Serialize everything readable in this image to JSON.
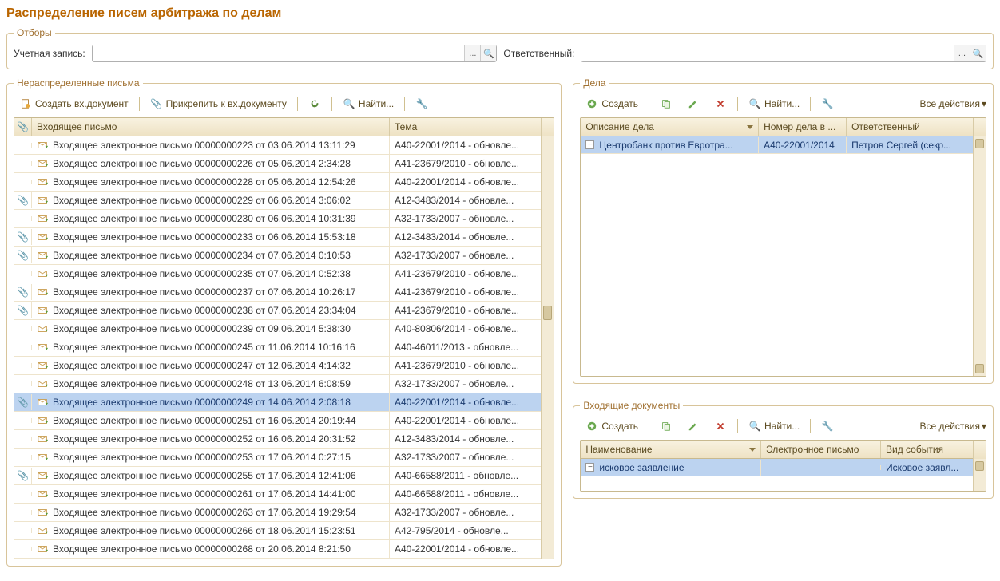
{
  "title": "Распределение писем арбитража по делам",
  "filters": {
    "legend": "Отборы",
    "account_label": "Учетная запись:",
    "account_value": "",
    "responsible_label": "Ответственный:",
    "responsible_value": ""
  },
  "letters": {
    "legend": "Нераспределенные письма",
    "toolbar": {
      "create": "Создать вх.документ",
      "attach": "Прикрепить к вх.документу",
      "find": "Найти..."
    },
    "columns": {
      "attach": "",
      "letter": "Входящее письмо",
      "subject": "Тема"
    },
    "rows": [
      {
        "att": false,
        "letter": "Входящее электронное письмо 00000000223 от 03.06.2014 13:11:29",
        "subj": "А40-22001/2014 - обновле..."
      },
      {
        "att": false,
        "letter": "Входящее электронное письмо 00000000226 от 05.06.2014 2:34:28",
        "subj": "А41-23679/2010 - обновле..."
      },
      {
        "att": false,
        "letter": "Входящее электронное письмо 00000000228 от 05.06.2014 12:54:26",
        "subj": "А40-22001/2014 - обновле..."
      },
      {
        "att": true,
        "letter": "Входящее электронное письмо 00000000229 от 06.06.2014 3:06:02",
        "subj": "А12-3483/2014 - обновле..."
      },
      {
        "att": false,
        "letter": "Входящее электронное письмо 00000000230 от 06.06.2014 10:31:39",
        "subj": "А32-1733/2007 - обновле..."
      },
      {
        "att": true,
        "letter": "Входящее электронное письмо 00000000233 от 06.06.2014 15:53:18",
        "subj": "А12-3483/2014 - обновле..."
      },
      {
        "att": true,
        "letter": "Входящее электронное письмо 00000000234 от 07.06.2014 0:10:53",
        "subj": "А32-1733/2007 - обновле..."
      },
      {
        "att": false,
        "letter": "Входящее электронное письмо 00000000235 от 07.06.2014 0:52:38",
        "subj": "А41-23679/2010 - обновле..."
      },
      {
        "att": true,
        "letter": "Входящее электронное письмо 00000000237 от 07.06.2014 10:26:17",
        "subj": "А41-23679/2010 - обновле..."
      },
      {
        "att": true,
        "letter": "Входящее электронное письмо 00000000238 от 07.06.2014 23:34:04",
        "subj": "А41-23679/2010 - обновле..."
      },
      {
        "att": false,
        "letter": "Входящее электронное письмо 00000000239 от 09.06.2014 5:38:30",
        "subj": "А40-80806/2014 - обновле..."
      },
      {
        "att": false,
        "letter": "Входящее электронное письмо 00000000245 от 11.06.2014 10:16:16",
        "subj": "А40-46011/2013 - обновле..."
      },
      {
        "att": false,
        "letter": "Входящее электронное письмо 00000000247 от 12.06.2014 4:14:32",
        "subj": "А41-23679/2010 - обновле..."
      },
      {
        "att": false,
        "letter": "Входящее электронное письмо 00000000248 от 13.06.2014 6:08:59",
        "subj": "А32-1733/2007 - обновле..."
      },
      {
        "att": true,
        "letter": "Входящее электронное письмо 00000000249 от 14.06.2014 2:08:18",
        "subj": "А40-22001/2014 - обновле...",
        "selected": true
      },
      {
        "att": false,
        "letter": "Входящее электронное письмо 00000000251 от 16.06.2014 20:19:44",
        "subj": "А40-22001/2014 - обновле..."
      },
      {
        "att": false,
        "letter": "Входящее электронное письмо 00000000252 от 16.06.2014 20:31:52",
        "subj": "А12-3483/2014 - обновле..."
      },
      {
        "att": false,
        "letter": "Входящее электронное письмо 00000000253 от 17.06.2014 0:27:15",
        "subj": "А32-1733/2007 - обновле..."
      },
      {
        "att": true,
        "letter": "Входящее электронное письмо 00000000255 от 17.06.2014 12:41:06",
        "subj": "А40-66588/2011 - обновле..."
      },
      {
        "att": false,
        "letter": "Входящее электронное письмо 00000000261 от 17.06.2014 14:41:00",
        "subj": "А40-66588/2011 - обновле..."
      },
      {
        "att": false,
        "letter": "Входящее электронное письмо 00000000263 от 17.06.2014 19:29:54",
        "subj": "А32-1733/2007 - обновле..."
      },
      {
        "att": false,
        "letter": "Входящее электронное письмо 00000000266 от 18.06.2014 15:23:51",
        "subj": "А42-795/2014 - обновле..."
      },
      {
        "att": false,
        "letter": "Входящее электронное письмо 00000000268 от 20.06.2014 8:21:50",
        "subj": "А40-22001/2014 - обновле..."
      }
    ]
  },
  "cases": {
    "legend": "Дела",
    "toolbar": {
      "create": "Создать",
      "find": "Найти...",
      "all_actions": "Все действия"
    },
    "columns": {
      "desc": "Описание дела",
      "num": "Номер дела в ...",
      "resp": "Ответственный"
    },
    "rows": [
      {
        "desc": "Центробанк против Евротра...",
        "num": "А40-22001/2014",
        "resp": "Петров Сергей (секр...",
        "selected": true
      }
    ]
  },
  "docs": {
    "legend": "Входящие документы",
    "toolbar": {
      "create": "Создать",
      "find": "Найти...",
      "all_actions": "Все действия"
    },
    "columns": {
      "name": "Наименование",
      "email": "Электронное письмо",
      "event": "Вид события"
    },
    "rows": [
      {
        "name": "исковое заявление",
        "email": "",
        "event": "Исковое заявл...",
        "selected": true
      }
    ]
  }
}
